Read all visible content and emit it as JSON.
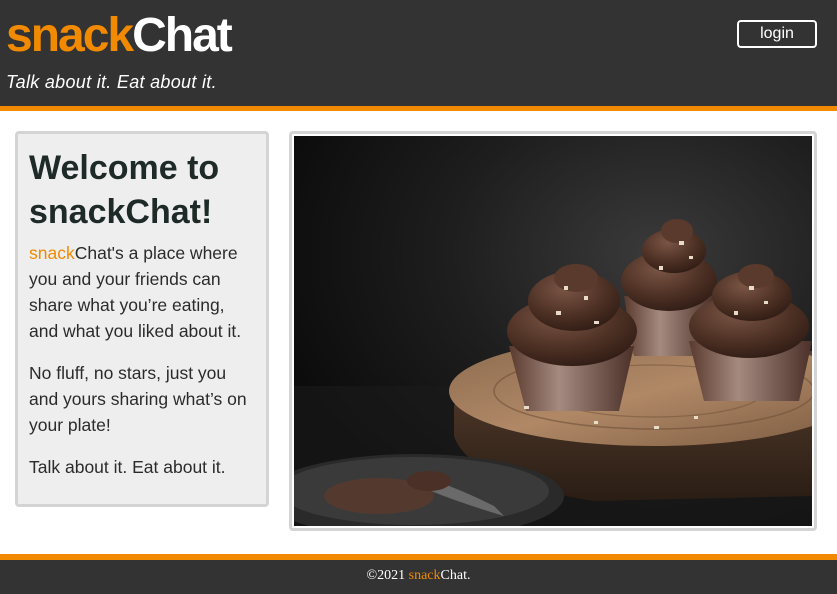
{
  "header": {
    "logo_part1": "snack",
    "logo_part2": "Chat",
    "tagline": "Talk about it. Eat about it.",
    "login_label": "login"
  },
  "welcome": {
    "title": "Welcome to snackChat!",
    "p1_highlight": "snack",
    "p1_rest": "Chat's a place where you and your friends can share what you’re eating, and what you liked about it.",
    "p2": "No fluff, no stars, just you and yours sharing what’s on your plate!",
    "p3": "Talk about it. Eat about it."
  },
  "footer": {
    "copyright": "©2021 ",
    "brand_highlight": "snack",
    "brand_rest": "Chat."
  },
  "colors": {
    "brand_orange": "#f28a00",
    "header_bg": "#333333",
    "panel_bg": "#eeeeee"
  }
}
